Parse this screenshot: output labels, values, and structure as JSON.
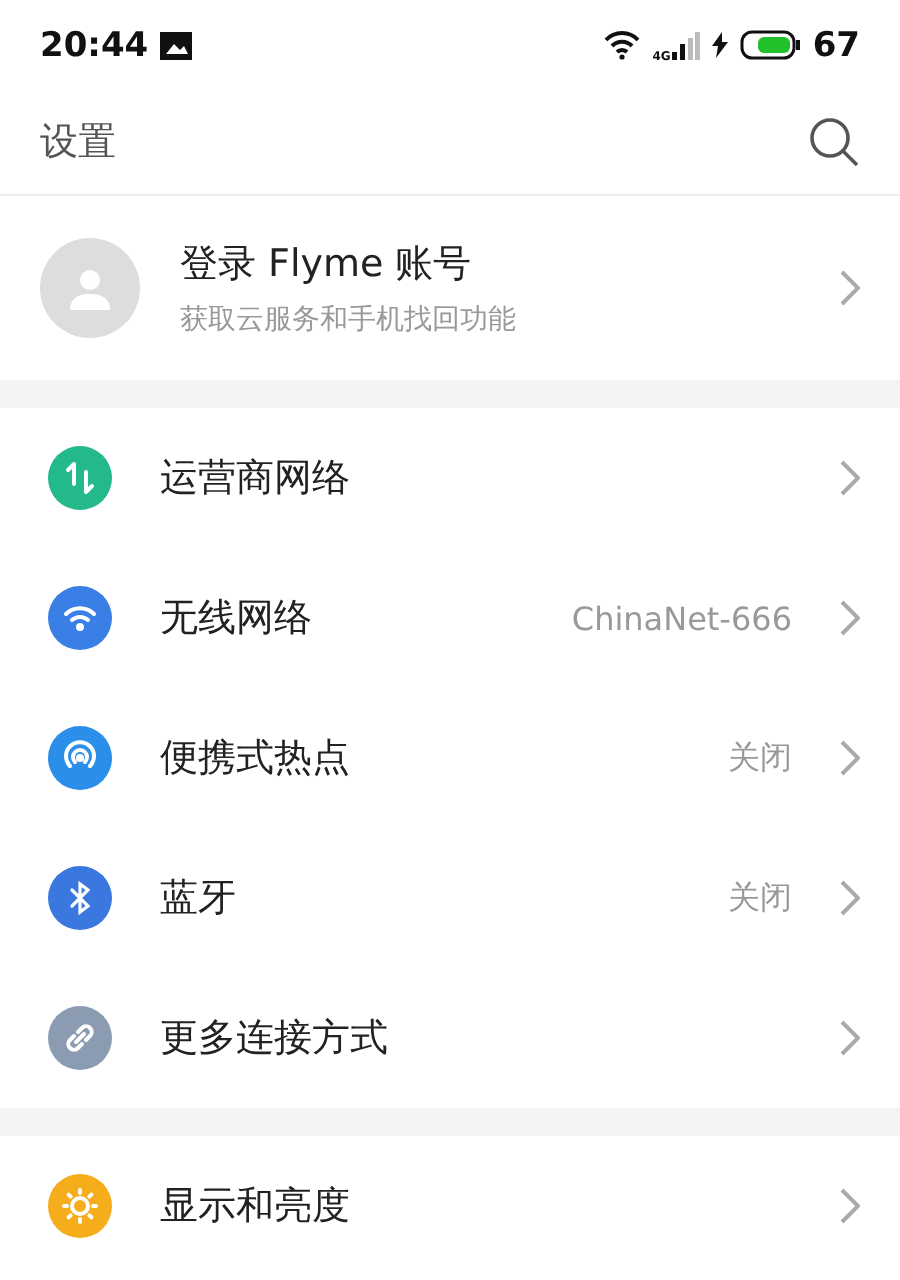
{
  "status_bar": {
    "time": "20:44",
    "network_type": "4G",
    "battery": "67"
  },
  "header": {
    "title": "设置"
  },
  "account": {
    "title": "登录 Flyme 账号",
    "subtitle": "获取云服务和手机找回功能"
  },
  "sections": [
    [
      {
        "kind": "cellular",
        "label": "运营商网络",
        "color": "#23b98a"
      },
      {
        "kind": "wifi",
        "label": "无线网络",
        "value": "ChinaNet-666",
        "color": "#3a7fe6"
      },
      {
        "kind": "hotspot",
        "label": "便携式热点",
        "value": "关闭",
        "color": "#2b8ee8"
      },
      {
        "kind": "bluetooth",
        "label": "蓝牙",
        "value": "关闭",
        "color": "#3a78e0"
      },
      {
        "kind": "link",
        "label": "更多连接方式",
        "color": "#8a9bb2"
      }
    ],
    [
      {
        "kind": "brightness",
        "label": "显示和亮度",
        "color": "#f5ad1b"
      }
    ]
  ]
}
